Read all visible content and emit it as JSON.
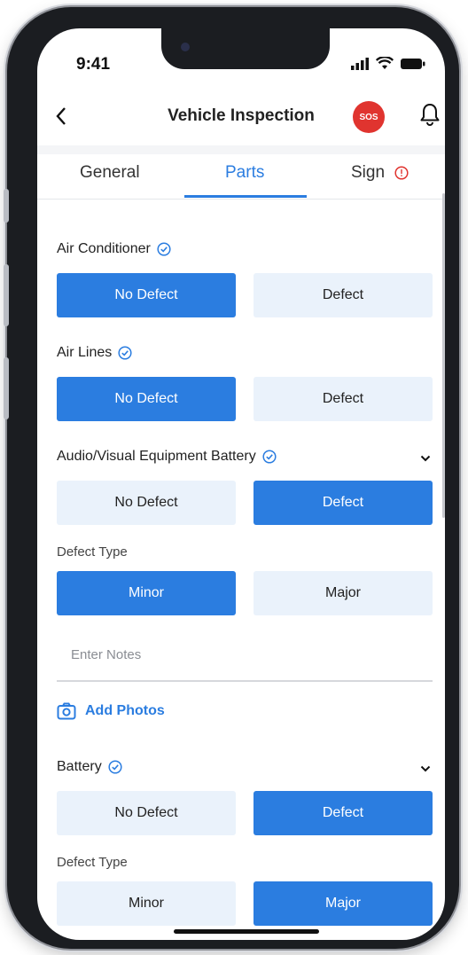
{
  "status_bar": {
    "time": "9:41"
  },
  "header": {
    "back_icon": "chevron-left-icon",
    "title": "Vehicle Inspection",
    "sos_label": "SOS",
    "bell_icon": "bell-icon"
  },
  "tabs": [
    {
      "label": "General",
      "active": false
    },
    {
      "label": "Parts",
      "active": true
    },
    {
      "label": "Sign",
      "active": false,
      "warning": true
    }
  ],
  "colors": {
    "accent": "#2b7de0",
    "selected_bg": "#2b7de0",
    "unselected_bg": "#eaf2fb",
    "sos": "#e0342f"
  },
  "items": [
    {
      "name": "Air Conditioner",
      "no_defect": "No Defect",
      "defect": "Defect",
      "selected": "No Defect"
    },
    {
      "name": "Air Lines",
      "no_defect": "No Defect",
      "defect": "Defect",
      "selected": "No Defect"
    },
    {
      "name": "Audio/Visual Equipment Battery",
      "no_defect": "No Defect",
      "defect": "Defect",
      "selected": "Defect",
      "defect_type_label": "Defect Type",
      "minor": "Minor",
      "major": "Major",
      "defect_type_selected": "Minor",
      "notes_placeholder": "Enter Notes",
      "add_photos": "Add Photos"
    },
    {
      "name": "Battery",
      "no_defect": "No Defect",
      "defect": "Defect",
      "selected": "Defect",
      "defect_type_label": "Defect Type",
      "minor": "Minor",
      "major": "Major",
      "defect_type_selected": "Major"
    }
  ]
}
